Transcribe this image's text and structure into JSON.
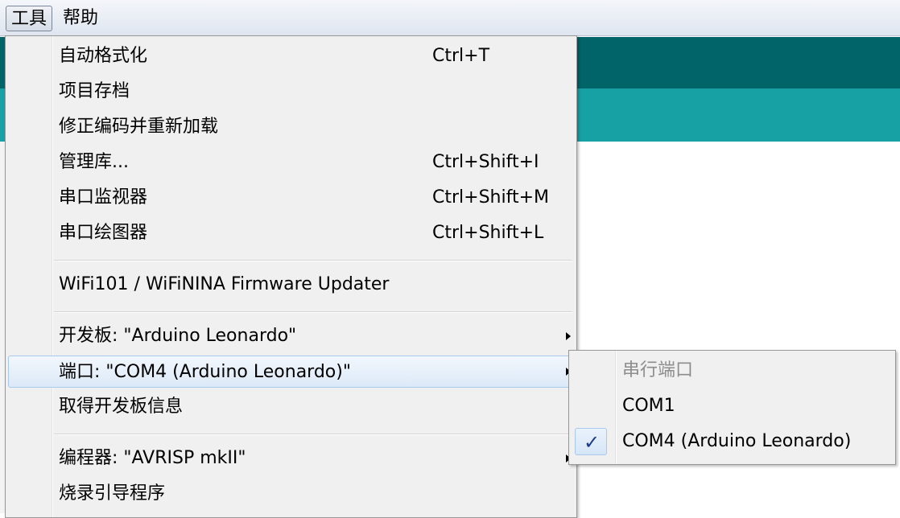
{
  "menubar": {
    "tools": "工具",
    "help": "帮助"
  },
  "tools_menu": {
    "items": [
      {
        "label": "自动格式化",
        "shortcut": "Ctrl+T"
      },
      {
        "label": "项目存档",
        "shortcut": ""
      },
      {
        "label": "修正编码并重新加载",
        "shortcut": ""
      },
      {
        "label": "管理库...",
        "shortcut": "Ctrl+Shift+I"
      },
      {
        "label": "串口监视器",
        "shortcut": "Ctrl+Shift+M"
      },
      {
        "label": "串口绘图器",
        "shortcut": "Ctrl+Shift+L"
      },
      {
        "label": "WiFi101 / WiFiNINA Firmware Updater",
        "shortcut": ""
      },
      {
        "label": "开发板: \"Arduino Leonardo\"",
        "shortcut": ""
      },
      {
        "label": "端口: \"COM4 (Arduino Leonardo)\"",
        "shortcut": ""
      },
      {
        "label": "取得开发板信息",
        "shortcut": ""
      },
      {
        "label": "编程器: \"AVRISP mkII\"",
        "shortcut": ""
      },
      {
        "label": "烧录引导程序",
        "shortcut": ""
      }
    ]
  },
  "port_submenu": {
    "header": "串行端口",
    "items": [
      {
        "label": "COM1",
        "checked": false
      },
      {
        "label": "COM4 (Arduino Leonardo)",
        "checked": true
      }
    ],
    "check_glyph": "✓"
  },
  "colors": {
    "editor_dark": "#006468",
    "editor_teal": "#17a1a5",
    "menu_bg": "#f0f0f0",
    "hover_border": "#a8c8ec"
  }
}
